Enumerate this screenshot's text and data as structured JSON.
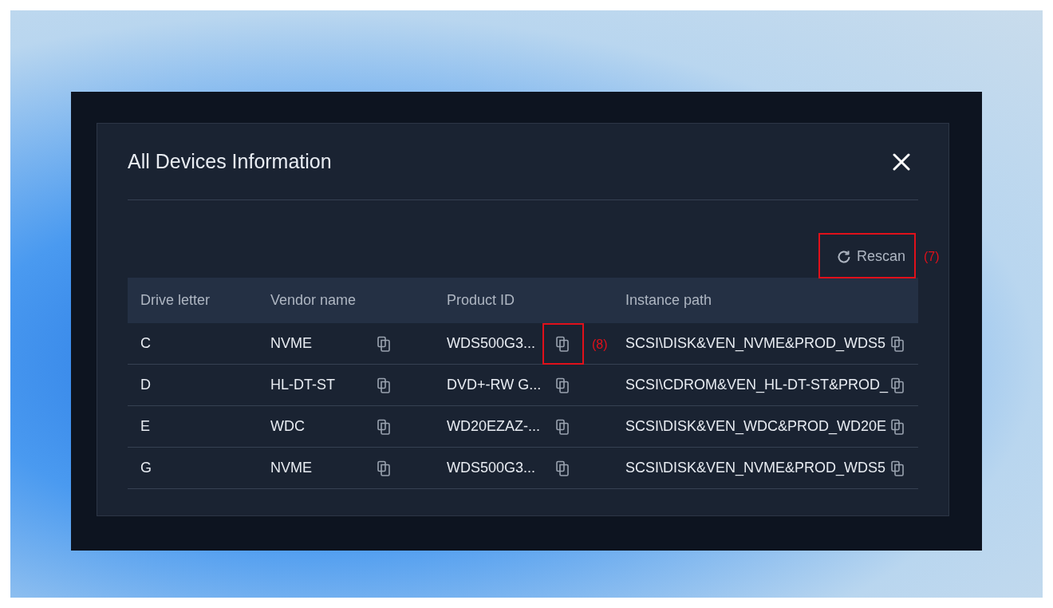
{
  "dialog": {
    "title": "All Devices Information"
  },
  "rescan": {
    "label": "Rescan",
    "annotation": "(7)"
  },
  "table": {
    "columns": [
      "Drive letter",
      "Vendor name",
      "Product ID",
      "Instance path"
    ],
    "rows": [
      {
        "drive": "C",
        "vendor": "NVME",
        "product": "WDS500G3...",
        "instance": "SCSI\\DISK&VEN_NVME&PROD_WDS5",
        "annotation": "(8)"
      },
      {
        "drive": "D",
        "vendor": "HL-DT-ST",
        "product": "DVD+-RW G...",
        "instance": "SCSI\\CDROM&VEN_HL-DT-ST&PROD_"
      },
      {
        "drive": "E",
        "vendor": "WDC",
        "product": "WD20EZAZ-...",
        "instance": "SCSI\\DISK&VEN_WDC&PROD_WD20E"
      },
      {
        "drive": "G",
        "vendor": "NVME",
        "product": "WDS500G3...",
        "instance": "SCSI\\DISK&VEN_NVME&PROD_WDS5"
      }
    ]
  }
}
